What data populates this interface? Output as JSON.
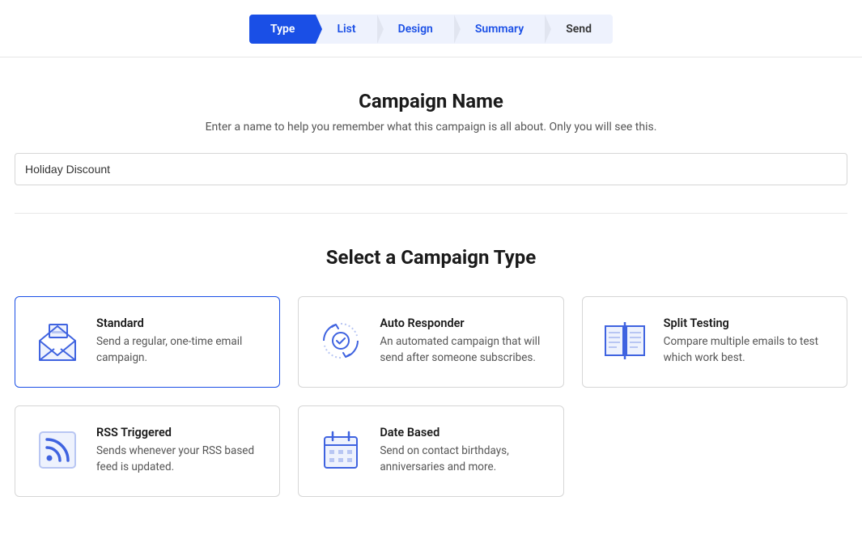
{
  "steps": [
    {
      "label": "Type",
      "state": "active"
    },
    {
      "label": "List",
      "state": "upcoming"
    },
    {
      "label": "Design",
      "state": "upcoming"
    },
    {
      "label": "Summary",
      "state": "upcoming"
    },
    {
      "label": "Send",
      "state": "future"
    }
  ],
  "name_section": {
    "title": "Campaign Name",
    "subtitle": "Enter a name to help you remember what this campaign is all about. Only you will see this.",
    "value": "Holiday Discount"
  },
  "type_section": {
    "title": "Select a Campaign Type",
    "options": [
      {
        "key": "standard",
        "title": "Standard",
        "desc": "Send a regular, one-time email campaign.",
        "selected": true
      },
      {
        "key": "auto-responder",
        "title": "Auto Responder",
        "desc": "An automated campaign that will send after someone subscribes.",
        "selected": false
      },
      {
        "key": "split-testing",
        "title": "Split Testing",
        "desc": "Compare multiple emails to test which work best.",
        "selected": false
      },
      {
        "key": "rss-triggered",
        "title": "RSS Triggered",
        "desc": "Sends whenever your RSS based feed is updated.",
        "selected": false
      },
      {
        "key": "date-based",
        "title": "Date Based",
        "desc": "Send on contact birthdays, anniversaries and more.",
        "selected": false
      }
    ]
  }
}
